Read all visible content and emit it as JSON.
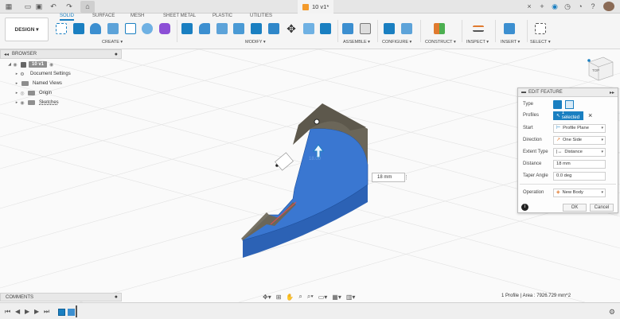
{
  "title_bar": {
    "document_title": "10 v1*",
    "icons": [
      "grid-menu-icon",
      "file-icon",
      "save-icon",
      "undo-icon",
      "redo-icon",
      "home-icon",
      "close-icon",
      "new-tab-icon",
      "extensions-icon",
      "job-status-icon",
      "notifications-icon",
      "help-icon",
      "user-avatar"
    ]
  },
  "ribbon": {
    "workspace_label": "DESIGN",
    "tabs": [
      "SOLID",
      "SURFACE",
      "MESH",
      "SHEET METAL",
      "PLASTIC",
      "UTILITIES"
    ],
    "active_tab": "SOLID",
    "groups": [
      "CREATE",
      "MODIFY",
      "ASSEMBLE",
      "CONFIGURE",
      "CONSTRUCT",
      "INSPECT",
      "INSERT",
      "SELECT"
    ],
    "accent_color": "#1a7fc1"
  },
  "browser": {
    "header": "BROWSER",
    "root": "10 v1",
    "items": [
      "Document Settings",
      "Named Views",
      "Origin",
      "Sketches"
    ]
  },
  "edit_feature": {
    "header": "EDIT FEATURE",
    "type_label": "Type",
    "profiles_label": "Profiles",
    "profiles_value": "1 selected",
    "start_label": "Start",
    "start_value": "Profile Plane",
    "direction_label": "Direction",
    "direction_value": "One Side",
    "extent_label": "Extent Type",
    "extent_value": "Distance",
    "distance_label": "Distance",
    "distance_value": "18 mm",
    "taper_label": "Taper Angle",
    "taper_value": "0.0 deg",
    "operation_label": "Operation",
    "operation_value": "New Body",
    "ok_label": "OK",
    "cancel_label": "Cancel"
  },
  "viewport": {
    "dimension_input": "18 mm",
    "dimension_overlay": "18.00",
    "viewcube_label": "TOP"
  },
  "comments": {
    "label": "COMMENTS"
  },
  "status": {
    "text": "1 Profile | Area : 7926.729 mm^2"
  }
}
